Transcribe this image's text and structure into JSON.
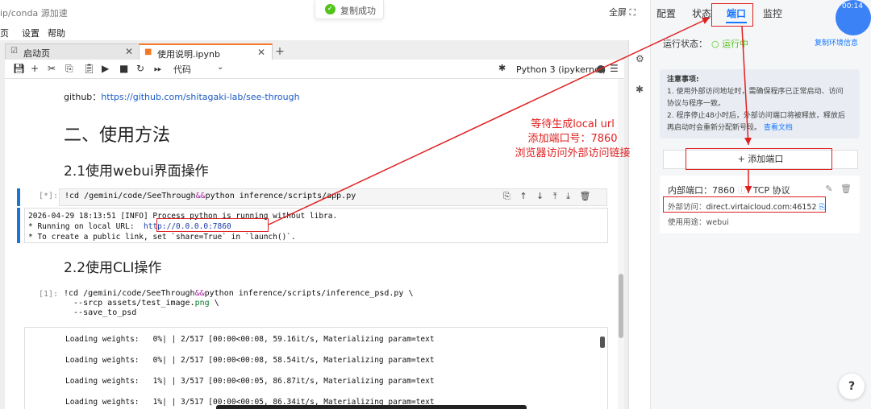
{
  "topbar": {
    "crumb": "ip/conda 源加速",
    "toast": "复制成功",
    "fullscreen": "全屏"
  },
  "menu": [
    "页",
    "设置",
    "帮助"
  ],
  "tabs": [
    {
      "label": "启动页"
    },
    {
      "label": "使用说明.ipynb"
    }
  ],
  "toolbar": {
    "celltype": "代码",
    "kernel": "Python 3 (ipykernel)"
  },
  "notebook": {
    "github_prefix": "github：",
    "github_link": "https://github.com/shitagaki-lab/see-through",
    "h1": "二、使用方法",
    "h21": "2.1使用webui界面操作",
    "cell1_prompt": "[*]:",
    "cell1_code": [
      "!cd /gemini/code/SeeThrough",
      "&&",
      "python inference/scripts/app.py"
    ],
    "cell1_out_1": "2026-04-29 18:13:51 [INFO] Process python is running without libra.",
    "cell1_out_2a": "* Running on local URL:  ",
    "cell1_out_2b": "http://0.0.0.0:7860",
    "cell1_out_3": "* To create a public link, set `share=True` in `launch()`.",
    "h22": "2.2使用CLI操作",
    "cell2_prompt": "[1]:",
    "cell2_l1a": "!cd /gemini/code/SeeThrough",
    "cell2_l1b": "&&",
    "cell2_l1c": "python inference/scripts/inference_psd.py \\",
    "cell2_l2a": "  --srcp assets/test_image.",
    "cell2_l2b": "png",
    "cell2_l2c": " \\",
    "cell2_l3": "  --save_to_psd",
    "cell2_out": [
      "Loading weights:   0%| | 2/517 [00:00<00:08, 59.16it/s, Materializing param=text",
      "Loading weights:   0%| | 2/517 [00:00<00:08, 58.54it/s, Materializing param=text",
      "Loading weights:   1%| | 3/517 [00:00<00:05, 86.87it/s, Materializing param=text",
      "Loading weights:   1%| | 3/517 [00:00<00:05, 86.34it/s, Materializing param=text"
    ]
  },
  "right_panel": {
    "tabs": [
      "配置",
      "状态",
      "端口",
      "监控"
    ],
    "selected_tab": "端口",
    "status_label": "运行状态：",
    "status_value": "运行中",
    "copy_env": "复制环境信息",
    "notice_title": "注意事项:",
    "notice_1": "1. 使用外部访问地址时，需确保程序已正常启动、访问",
    "notice_1b": "协议与程序一致。",
    "notice_2": "2. 程序停止48小时后，外部访问端口将被释放，释放后",
    "notice_2b": "再启动时会重新分配新号段。",
    "notice_link": "查看文档",
    "add_port": "+ 添加端口",
    "inner_port_label": "内部端口：",
    "inner_port": "7860",
    "protocol": "TCP 协议",
    "external_label": "外部访问：",
    "external_url": "direct.virtaicloud.com:46152",
    "usage_label": "使用用途：",
    "usage": "webui"
  },
  "timer": "00:14",
  "annotation": {
    "line1": "等待生成local url",
    "line2": "添加端口号：7860",
    "line3": "浏览器访问外部访问链接"
  },
  "colors": {
    "accent": "#1677ff",
    "annotation": "#e02020",
    "running": "#52c41a"
  }
}
